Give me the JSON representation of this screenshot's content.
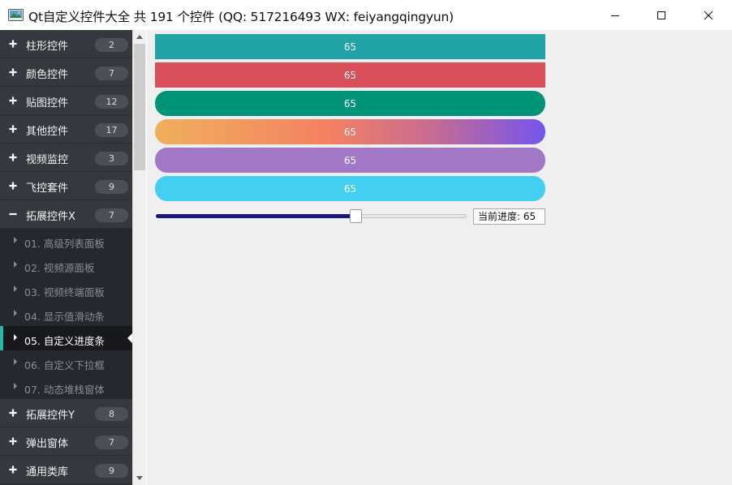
{
  "window": {
    "title": "Qt自定义控件大全 共 191 个控件 (QQ: 517216493 WX: feiyangqingyun)"
  },
  "sidebar": {
    "groups_top": [
      {
        "label": "柱形控件",
        "count": "2",
        "expanded": false
      },
      {
        "label": "颜色控件",
        "count": "7",
        "expanded": false
      },
      {
        "label": "贴图控件",
        "count": "12",
        "expanded": false
      },
      {
        "label": "其他控件",
        "count": "17",
        "expanded": false
      },
      {
        "label": "视频监控",
        "count": "3",
        "expanded": false
      },
      {
        "label": "飞控套件",
        "count": "9",
        "expanded": false
      },
      {
        "label": "拓展控件X",
        "count": "7",
        "expanded": true
      }
    ],
    "children": [
      {
        "label": "01. 高级列表面板",
        "active": false
      },
      {
        "label": "02. 视频源面板",
        "active": false
      },
      {
        "label": "03. 视频终端面板",
        "active": false
      },
      {
        "label": "04. 显示值滑动条",
        "active": false
      },
      {
        "label": "05. 自定义进度条",
        "active": true
      },
      {
        "label": "06. 自定义下拉框",
        "active": false
      },
      {
        "label": "07. 动态堆栈窗体",
        "active": false
      }
    ],
    "groups_bottom": [
      {
        "label": "拓展控件Y",
        "count": "8",
        "expanded": false
      },
      {
        "label": "弹出窗体",
        "count": "7",
        "expanded": false
      },
      {
        "label": "通用类库",
        "count": "9",
        "expanded": false
      }
    ]
  },
  "progress_bars": [
    {
      "value_text": "65",
      "color": "#22a3a8",
      "rounded": false
    },
    {
      "value_text": "65",
      "color": "#d9505a",
      "rounded": false
    },
    {
      "value_text": "65",
      "color": "#009479",
      "rounded": true
    },
    {
      "value_text": "65",
      "color": "gradient",
      "rounded": true
    },
    {
      "value_text": "65",
      "color": "#a277c6",
      "rounded": true
    },
    {
      "value_text": "65",
      "color": "#42cff2",
      "rounded": true
    }
  ],
  "slider": {
    "value": 65,
    "min": 0,
    "max": 100,
    "fill_color": "#1b1580"
  },
  "progress_label": "当前进度: 65",
  "colors": {
    "sidebar_bg": "#2e3039",
    "active_accent": "#2ab6a6",
    "content_bg": "#efefef"
  }
}
